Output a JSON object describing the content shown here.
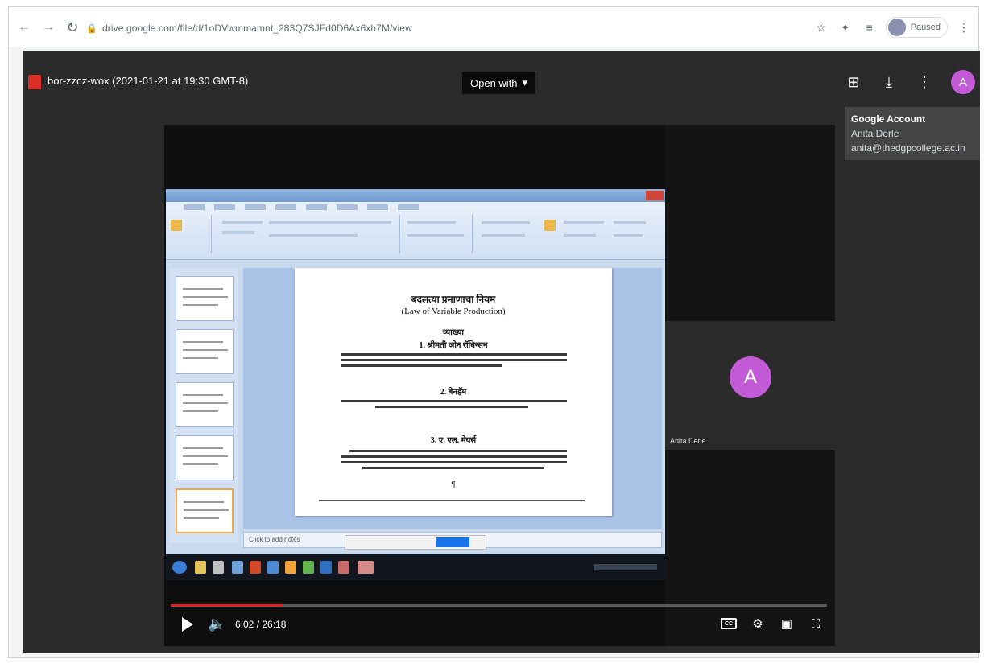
{
  "browser": {
    "url": "drive.google.com/file/d/1oDVwmmamnt_283Q7SJFd0D6Ax6xh7M/view",
    "profile_label": "Paused"
  },
  "viewer": {
    "file_title": "bor-zzcz-wox (2021-01-21 at 19:30 GMT-8)",
    "open_with_label": "Open with",
    "account_avatar_letter": "A",
    "account_popup": {
      "heading": "Google Account",
      "name": "Anita Derle",
      "email": "anita@thedgpcollege.ac.in"
    }
  },
  "video": {
    "participant_initial": "A",
    "participant_name": "Anita Derle",
    "current_time": "6:02 / 26:18",
    "progress": 0.17,
    "slide": {
      "title": "बदलत्या प्रमाणाचा नियम",
      "subtitle": "(Law of Variable Production)",
      "heading_definitions": "व्याख्या",
      "item1": "1. श्रीमती जोन रॉबिन्सन",
      "item2": "2. बेनहॅम",
      "item3": "3. ए. एल. मेयर्स",
      "footer_mark": "¶"
    },
    "notes_placeholder": "Click to add notes"
  },
  "colors": {
    "progress": "#e02424",
    "avatar": "#c35bd6"
  }
}
